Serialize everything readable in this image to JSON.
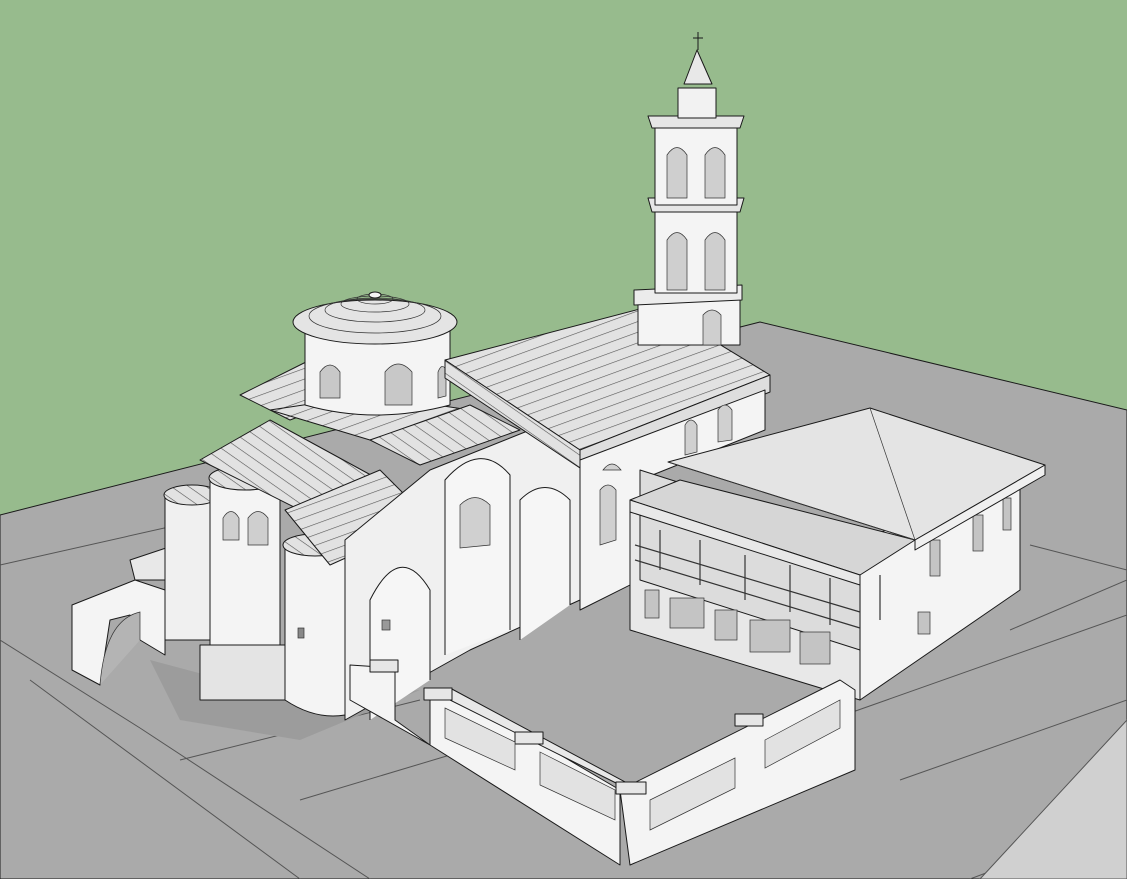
{
  "viewport": {
    "sky_color": "#97bb8d",
    "ground_color": "#aaaaaa",
    "road_color": "#bdbdbd",
    "wall_color": "#f4f4f4",
    "shade_color": "#dcdcdc",
    "roof_color": "#e0e0e0",
    "edge_color": "#1a1a1a"
  },
  "scene": {
    "icons": [
      "cross-icon"
    ]
  }
}
